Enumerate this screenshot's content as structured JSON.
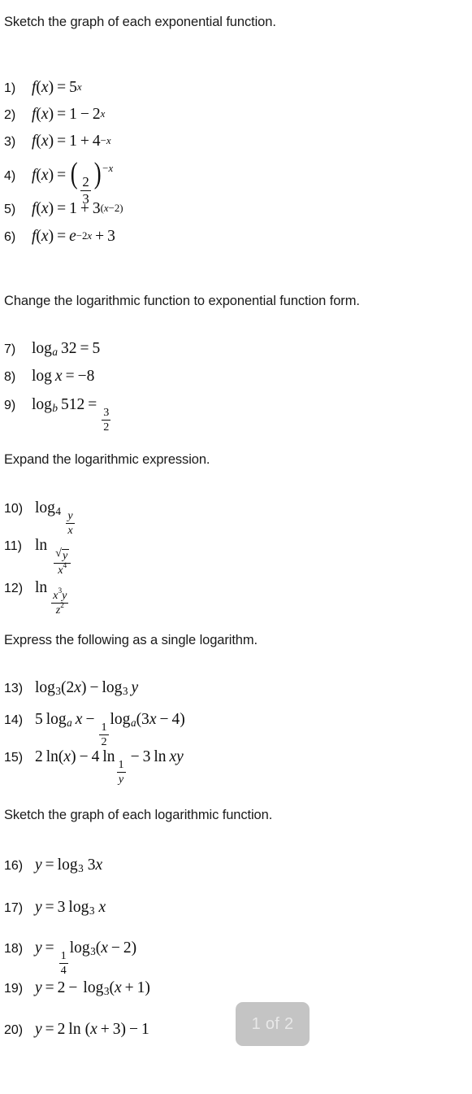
{
  "document": {
    "type": "math-worksheet",
    "page_indicator": "1 of 2",
    "badge_color": "#c4c4c4",
    "badge_text_color": "#e8e8e8",
    "text_color": "#0d0d0d",
    "background_color": "#ffffff"
  },
  "sections": [
    {
      "id": "s1",
      "heading": "Sketch the graph of each exponential function."
    },
    {
      "id": "s2",
      "heading": "Change the logarithmic function to exponential function form."
    },
    {
      "id": "s3",
      "heading": "Expand the logarithmic expression."
    },
    {
      "id": "s4",
      "heading": "Express the following as a single logarithm."
    },
    {
      "id": "s5",
      "heading": "Sketch the graph of each logarithmic function."
    }
  ],
  "problems": [
    {
      "number": "1)",
      "section": "s1",
      "text": "f(x) = 5^x"
    },
    {
      "number": "2)",
      "section": "s1",
      "text": "f(x) = 1 - 2^x"
    },
    {
      "number": "3)",
      "section": "s1",
      "text": "f(x) = 1 + 4^(-x)"
    },
    {
      "number": "4)",
      "section": "s1",
      "text": "f(x) = (2/3)^(-x)"
    },
    {
      "number": "5)",
      "section": "s1",
      "text": "f(x) = 1 + 3^(x-2)"
    },
    {
      "number": "6)",
      "section": "s1",
      "text": "f(x) = e^(-2x) + 3"
    },
    {
      "number": "7)",
      "section": "s2",
      "text": "log_a 32 = 5"
    },
    {
      "number": "8)",
      "section": "s2",
      "text": "log x = -8"
    },
    {
      "number": "9)",
      "section": "s2",
      "text": "log_b 512 = 3/2"
    },
    {
      "number": "10)",
      "section": "s3",
      "text": "log_4 (y/x)"
    },
    {
      "number": "11)",
      "section": "s3",
      "text": "ln (sqrt(y)/x^4)"
    },
    {
      "number": "12)",
      "section": "s3",
      "text": "ln (x^3 y / z^2)"
    },
    {
      "number": "13)",
      "section": "s4",
      "text": "log_3(2x) - log_3 y"
    },
    {
      "number": "14)",
      "section": "s4",
      "text": "5 log_a x - (1/2) log_a(3x - 4)"
    },
    {
      "number": "15)",
      "section": "s4",
      "text": "2 ln(x) - 4 ln(1/y) - 3 ln xy"
    },
    {
      "number": "16)",
      "section": "s5",
      "text": "y = log_3 3x"
    },
    {
      "number": "17)",
      "section": "s5",
      "text": "y = 3 log_3 x"
    },
    {
      "number": "18)",
      "section": "s5",
      "text": "y = (1/4) log_3(x - 2)"
    },
    {
      "number": "19)",
      "section": "s5",
      "text": "y = 2 - log_3(x + 1)"
    },
    {
      "number": "20)",
      "section": "s5",
      "text": "y = 2 ln (x + 3) - 1"
    }
  ],
  "tokens": {
    "f": "f",
    "x": "x",
    "y": "y",
    "z": "z",
    "e": "e",
    "a": "a",
    "b": "b",
    "log": "log",
    "ln": "ln",
    "eq": "=",
    "minus": "−",
    "plus": "+",
    "lp": "(",
    "rp": ")",
    "n1": "1",
    "n2": "2",
    "n3": "3",
    "n4": "4",
    "n5": "5",
    "n8": "8",
    "n32": "32",
    "n512": "512",
    "neg8": "−8",
    "sub2": "2",
    "sub3": "3",
    "sub4": "4",
    "two_x": "2x",
    "three_x": "3x",
    "xy": "xy",
    "radical": "√"
  }
}
